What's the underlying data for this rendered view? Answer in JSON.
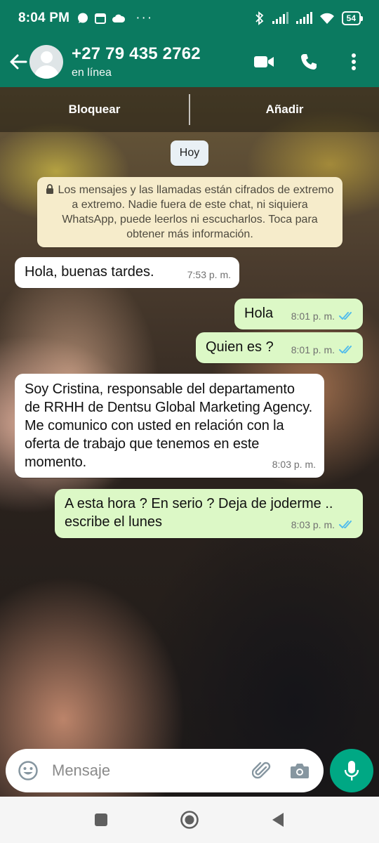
{
  "status_bar": {
    "time": "8:04 PM",
    "battery": "54"
  },
  "header": {
    "contact_name": "+27 79 435 2762",
    "contact_status": "en línea"
  },
  "action_bar": {
    "block_label": "Bloquear",
    "add_label": "Añadir"
  },
  "chat": {
    "date_chip": "Hoy",
    "e2e_notice": "Los mensajes y las llamadas están cifrados de extremo a extremo. Nadie fuera de este chat, ni siquiera WhatsApp, puede leerlos ni escucharlos. Toca para obtener más información.",
    "messages": [
      {
        "direction": "in",
        "text": "Hola, buenas tardes.",
        "time": "7:53 p. m."
      },
      {
        "direction": "out",
        "text": "Hola",
        "time": "8:01 p. m.",
        "read": true
      },
      {
        "direction": "out",
        "text": "Quien es ?",
        "time": "8:01 p. m.",
        "read": true
      },
      {
        "direction": "in",
        "text": "Soy Cristina, responsable del departamento de RRHH de Dentsu Global Marketing Agency. Me comunico con usted en relación con la oferta de trabajo que tenemos en este momento.",
        "time": "8:03 p. m."
      },
      {
        "direction": "out",
        "text": "A esta hora ? En serio ? Deja de joderme .. escribe el lunes",
        "time": "8:03 p. m.",
        "read": true
      }
    ]
  },
  "composer": {
    "placeholder": "Mensaje"
  },
  "colors": {
    "header": "#0b7a60",
    "incoming_bubble": "#ffffff",
    "outgoing_bubble": "#dcf8c6",
    "read_ticks": "#53bdeb",
    "mic_button": "#00a884"
  },
  "icons": [
    "back-arrow-icon",
    "video-call-icon",
    "phone-icon",
    "more-vert-icon",
    "lock-icon",
    "emoji-icon",
    "attach-icon",
    "camera-icon",
    "mic-icon"
  ]
}
